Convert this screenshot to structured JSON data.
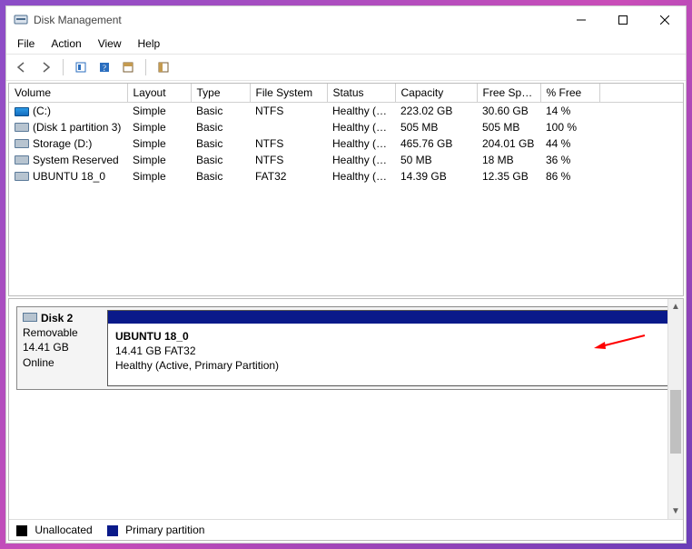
{
  "window": {
    "title": "Disk Management"
  },
  "menubar": [
    "File",
    "Action",
    "View",
    "Help"
  ],
  "columns": [
    "Volume",
    "Layout",
    "Type",
    "File System",
    "Status",
    "Capacity",
    "Free Spa...",
    "% Free"
  ],
  "volumes": [
    {
      "icon": "blue",
      "name": "(C:)",
      "layout": "Simple",
      "type": "Basic",
      "fs": "NTFS",
      "status": "Healthy (B...",
      "capacity": "223.02 GB",
      "free": "30.60 GB",
      "pct": "14 %"
    },
    {
      "icon": "grey",
      "name": "(Disk 1 partition 3)",
      "layout": "Simple",
      "type": "Basic",
      "fs": "",
      "status": "Healthy (R...",
      "capacity": "505 MB",
      "free": "505 MB",
      "pct": "100 %"
    },
    {
      "icon": "grey",
      "name": "Storage (D:)",
      "layout": "Simple",
      "type": "Basic",
      "fs": "NTFS",
      "status": "Healthy (P...",
      "capacity": "465.76 GB",
      "free": "204.01 GB",
      "pct": "44 %"
    },
    {
      "icon": "grey",
      "name": "System Reserved",
      "layout": "Simple",
      "type": "Basic",
      "fs": "NTFS",
      "status": "Healthy (S...",
      "capacity": "50 MB",
      "free": "18 MB",
      "pct": "36 %"
    },
    {
      "icon": "grey",
      "name": "UBUNTU 18_0",
      "layout": "Simple",
      "type": "Basic",
      "fs": "FAT32",
      "status": "Healthy (A...",
      "capacity": "14.39 GB",
      "free": "12.35 GB",
      "pct": "86 %"
    }
  ],
  "disk": {
    "label": "Disk 2",
    "media": "Removable",
    "size": "14.41 GB",
    "state": "Online",
    "partition": {
      "name": "UBUNTU 18_0",
      "size_fs": "14.41 GB FAT32",
      "status": "Healthy (Active, Primary Partition)"
    }
  },
  "legend": {
    "unallocated": {
      "label": "Unallocated",
      "color": "#000000"
    },
    "primary": {
      "label": "Primary partition",
      "color": "#0a1a8a"
    }
  }
}
